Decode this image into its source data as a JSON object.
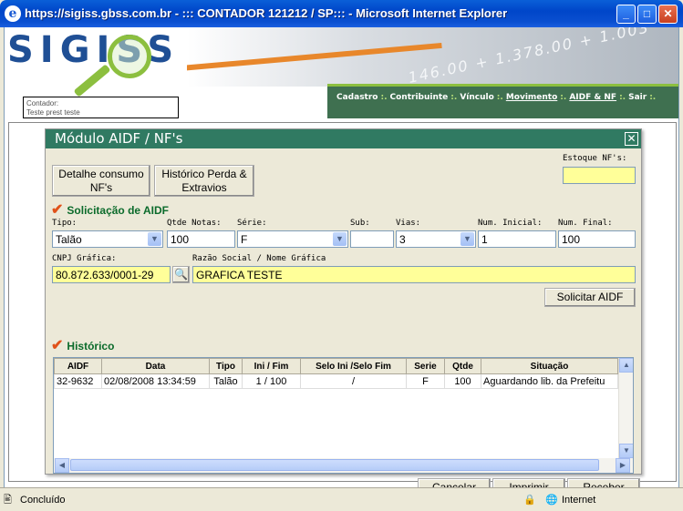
{
  "window": {
    "title": "https://sigiss.gbss.com.br - ::: CONTADOR 121212 / SP::: - Microsoft Internet Explorer",
    "buttons": [
      "_",
      "□",
      "✕"
    ]
  },
  "header": {
    "logo_text": "SIGISS",
    "banner_digits": "146.00 + 1.378.00 + 1.003",
    "menu": [
      {
        "label": "Cadastro",
        "underline": false
      },
      {
        "label": "Contribuinte",
        "underline": false
      },
      {
        "label": "Vínculo",
        "underline": false
      },
      {
        "label": "Movimento",
        "underline": true
      },
      {
        "label": "AIDF & NF",
        "underline": true
      },
      {
        "label": "Sair",
        "underline": false
      }
    ],
    "menu_separator": ":.",
    "contador_label": "Contador:",
    "contador_value": "Teste prest teste"
  },
  "modal": {
    "title": "Módulo AIDF / NF's",
    "close": "✕",
    "btn_detalhe": "Detalhe consumo NF's",
    "btn_historico": "Histórico Perda & Extravios",
    "estoque_label": "Estoque NF's:",
    "estoque_value": "",
    "section_solicitacao": "Solicitação de AIDF",
    "labels": {
      "tipo": "Tipo:",
      "qtde": "Qtde Notas:",
      "serie": "Série:",
      "sub": "Sub:",
      "vias": "Vias:",
      "num_inicial": "Num. Inicial:",
      "num_final": "Num. Final:",
      "cnpj": "CNPJ Gráfica:",
      "razao": "Razão Social / Nome Gráfica"
    },
    "values": {
      "tipo": "Talão",
      "qtde": "100",
      "serie": "F",
      "sub": "",
      "vias": "3",
      "num_inicial": "1",
      "num_final": "100",
      "cnpj": "80.872.633/0001-29",
      "razao": "GRAFICA TESTE"
    },
    "btn_solicitar": "Solicitar AIDF",
    "section_historico": "Histórico",
    "table": {
      "headers": [
        "AIDF",
        "Data",
        "Tipo",
        "Ini / Fim",
        "Selo Ini /Selo Fim",
        "Serie",
        "Qtde",
        "Situação"
      ],
      "rows": [
        [
          "32-9632",
          "02/08/2008 13:34:59",
          "Talão",
          "1 / 100",
          "/",
          "F",
          "100",
          "Aguardando lib. da Prefeitu"
        ]
      ]
    },
    "btn_cancelar": "Cancelar",
    "btn_imprimir": "Imprimir",
    "btn_receber": "Receber"
  },
  "statusbar": {
    "status": "Concluído",
    "zone": "Internet"
  },
  "colors": {
    "title_green": "#307a62",
    "section_green": "#0b6b2b",
    "highlight_yellow": "#ffff99",
    "xp_blue": "#0046C9"
  }
}
